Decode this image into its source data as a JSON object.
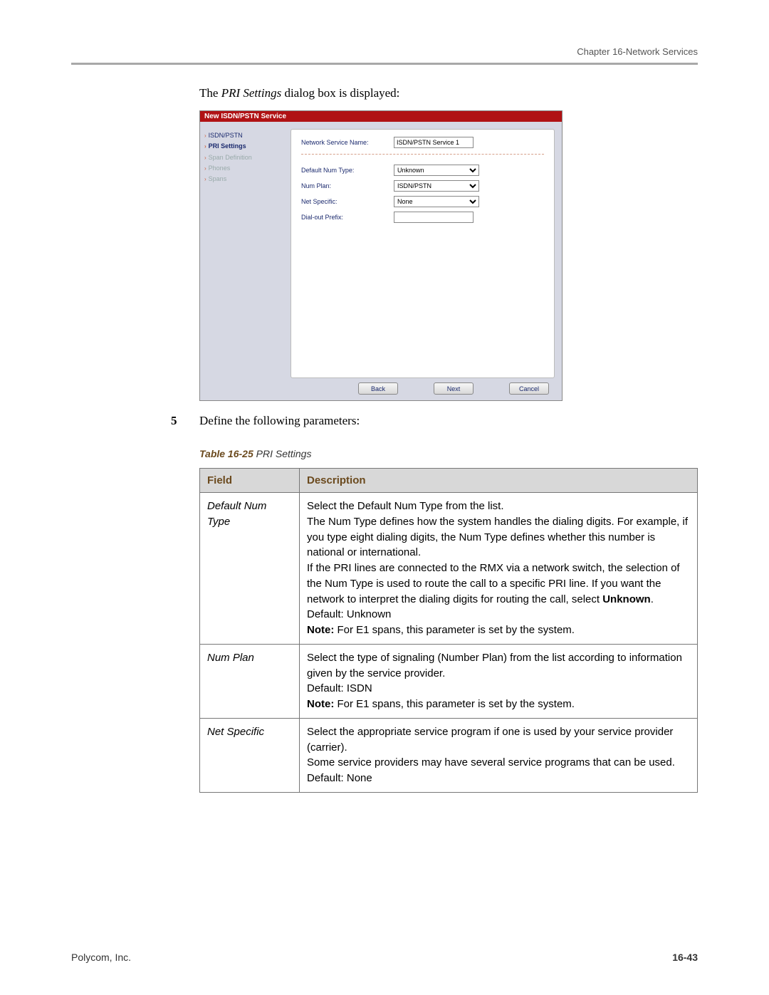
{
  "header": {
    "chapter": "Chapter 16-Network Services"
  },
  "intro": {
    "pre": "The ",
    "italic": "PRI Settings",
    "post": " dialog box is displayed:"
  },
  "dialog": {
    "title": "New ISDN/PSTN Service",
    "sidebar": {
      "items": [
        {
          "label": "ISDN/PSTN",
          "state": "normal"
        },
        {
          "label": "PRI Settings",
          "state": "active"
        },
        {
          "label": "Span Definition",
          "state": "disabled"
        },
        {
          "label": "Phones",
          "state": "disabled"
        },
        {
          "label": "Spans",
          "state": "disabled"
        }
      ]
    },
    "form": {
      "serviceName": {
        "label": "Network Service Name:",
        "value": "ISDN/PSTN Service 1"
      },
      "defaultNumType": {
        "label": "Default Num Type:",
        "value": "Unknown"
      },
      "numPlan": {
        "label": "Num Plan:",
        "value": "ISDN/PSTN"
      },
      "netSpecific": {
        "label": "Net Specific:",
        "value": "None"
      },
      "dialOutPrefix": {
        "label": "Dial-out Prefix:",
        "value": ""
      }
    },
    "buttons": {
      "back": "Back",
      "next": "Next",
      "cancel": "Cancel"
    }
  },
  "step": {
    "num": "5",
    "text": "Define the following parameters:"
  },
  "tableCaption": {
    "bold": "Table 16-25",
    "rest": " PRI Settings"
  },
  "tableHeaders": {
    "field": "Field",
    "desc": "Description"
  },
  "table": [
    {
      "field": "Default Num Type",
      "desc_parts": [
        {
          "t": "Select the Default Num Type from the list."
        },
        {
          "t": "The Num Type defines how the system handles the dialing digits. For example, if you type eight dialing digits, the Num Type defines whether this number is national or international."
        },
        {
          "t": "If the PRI lines are connected to the RMX via a network switch, the selection of the Num Type is used to route the call to a specific PRI line. If you want the network to interpret the dialing digits for routing the call, select ",
          "bold_after": "Unknown",
          "tail": "."
        },
        {
          "t": "Default: Unknown"
        },
        {
          "bold": "Note:",
          "t": " For E1 spans, this parameter is set by the system."
        }
      ]
    },
    {
      "field": "Num Plan",
      "desc_parts": [
        {
          "t": "Select the type of signaling (Number Plan) from the list according to information given by the service provider."
        },
        {
          "t": "Default: ISDN"
        },
        {
          "bold": "Note:",
          "t": " For E1 spans, this parameter is set by the system."
        }
      ]
    },
    {
      "field": "Net Specific",
      "desc_parts": [
        {
          "t": "Select the appropriate service program if one is used by your service provider (carrier)."
        },
        {
          "t": "Some service providers may have several service programs that can be used."
        },
        {
          "t": "Default: None"
        }
      ]
    }
  ],
  "footer": {
    "left": "Polycom, Inc.",
    "right": "16-43"
  }
}
